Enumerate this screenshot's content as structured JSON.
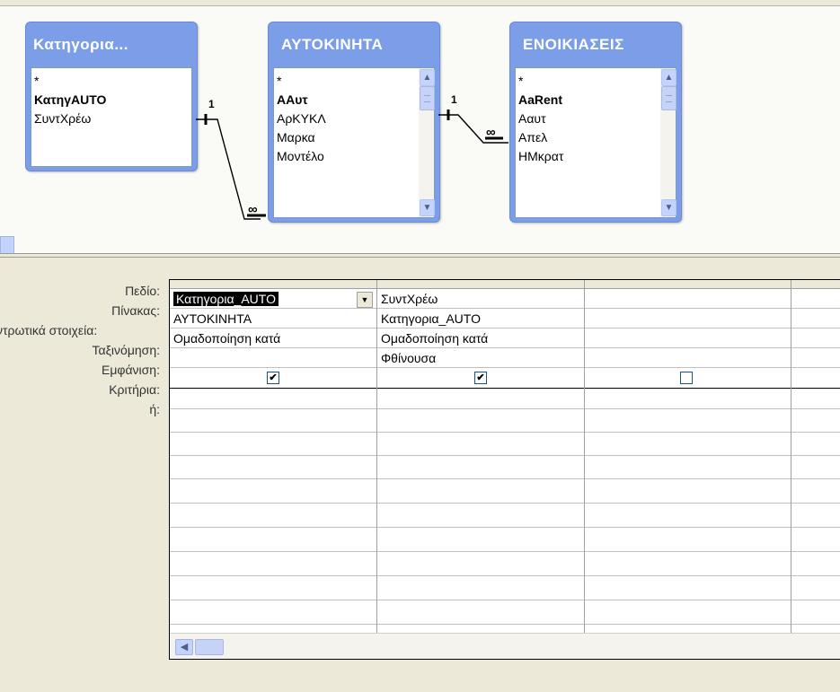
{
  "tables": [
    {
      "title": "Κατηγορια...",
      "fields": [
        {
          "label": "*",
          "key": false
        },
        {
          "label": "ΚατηγAUTO",
          "key": true
        },
        {
          "label": "ΣυντΧρέω",
          "key": false
        }
      ]
    },
    {
      "title": "ΑΥΤΟΚΙΝΗΤΑ",
      "fields": [
        {
          "label": "*",
          "key": false
        },
        {
          "label": "AAυτ",
          "key": true
        },
        {
          "label": "ΑρΚΥΚΛ",
          "key": false
        },
        {
          "label": "Μαρκα",
          "key": false
        },
        {
          "label": "Μοντέλο",
          "key": false
        }
      ]
    },
    {
      "title": "ΕΝΟΙΚΙΑΣΕΙΣ",
      "fields": [
        {
          "label": "*",
          "key": false
        },
        {
          "label": "AaRent",
          "key": true
        },
        {
          "label": "Aαυτ",
          "key": false
        },
        {
          "label": "Απελ",
          "key": false
        },
        {
          "label": "ΗΜκρατ",
          "key": false
        }
      ]
    }
  ],
  "relationships": {
    "one_label": "1",
    "many_label": "∞"
  },
  "row_labels": [
    "Πεδίο:",
    "Πίνακας:",
    "ντρωτικά στοιχεία:",
    "Ταξινόμηση:",
    "Εμφάνιση:",
    "Κριτήρια:",
    "ή:"
  ],
  "columns": [
    {
      "field": "Κατηγορια_AUTO",
      "table": "ΑΥΤΟΚΙΝΗΤΑ",
      "total": "Ομαδοποίηση κατά",
      "sort": "",
      "show": true
    },
    {
      "field": "ΣυντΧρέω",
      "table": "Κατηγορια_AUTO",
      "total": "Ομαδοποίηση κατά",
      "sort": "Φθίνουσα",
      "show": true
    },
    {
      "field": "",
      "table": "",
      "total": "",
      "sort": "",
      "show": false
    }
  ],
  "icons": {
    "scroll_up": "▲",
    "scroll_down": "▼",
    "scroll_left": "◀",
    "dropdown": "▼",
    "check": "✔"
  }
}
